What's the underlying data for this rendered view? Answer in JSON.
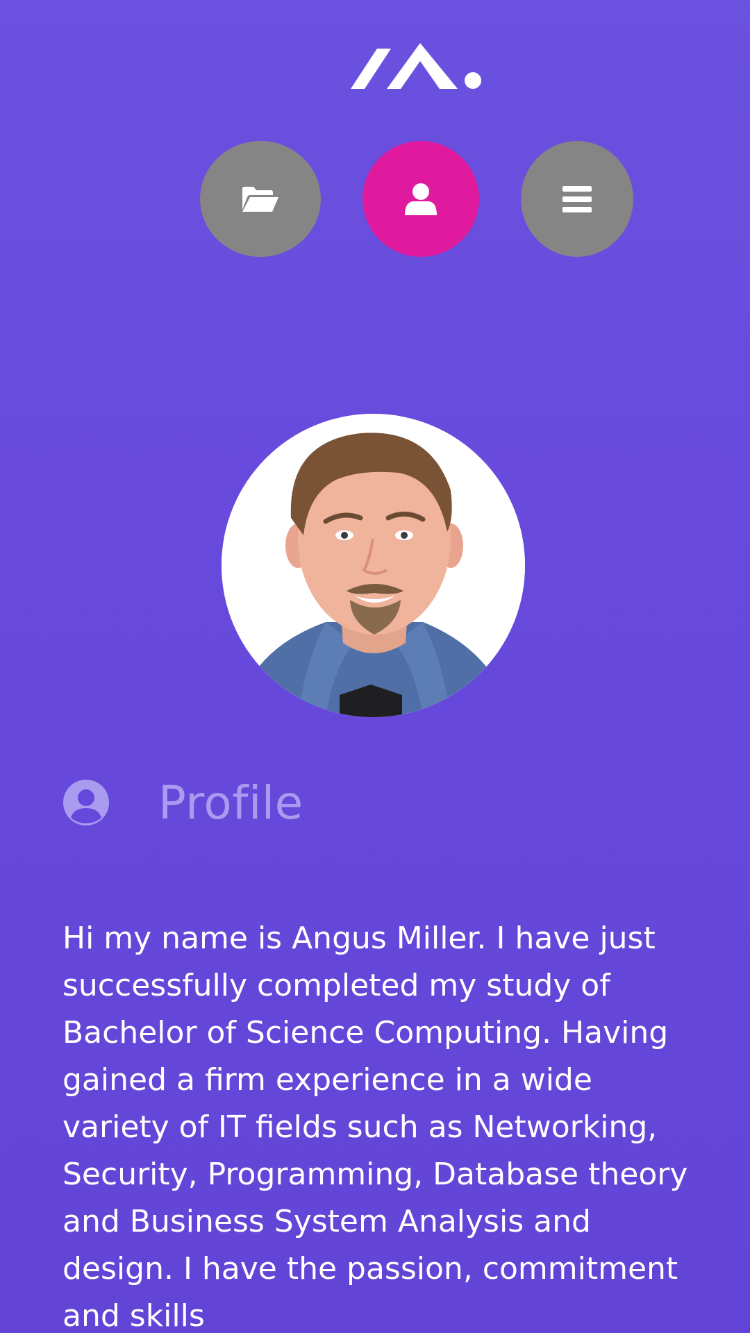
{
  "brand": {
    "logo_icon": "brand-logo"
  },
  "nav": {
    "items": [
      {
        "icon": "folder-open-icon",
        "active": false
      },
      {
        "icon": "user-icon",
        "active": true
      },
      {
        "icon": "menu-icon",
        "active": false
      }
    ],
    "active_color": "#e01a9f",
    "inactive_color": "#858585"
  },
  "profile": {
    "heading": "Profile",
    "heading_icon": "user-circle-icon",
    "bio": "Hi my name is Angus Miller. I have just successfully completed my study of Bachelor of Science Computing. Having gained a firm experience in a wide variety of IT fields such as Networking, Security, Programming, Database theory and Business System Analysis and design. I have the passion, commitment and skills"
  },
  "colors": {
    "background": "#6749dc",
    "heading_text": "#a99cf0",
    "body_text": "#ffffff"
  }
}
